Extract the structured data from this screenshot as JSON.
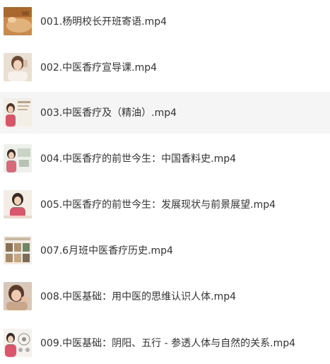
{
  "files": [
    {
      "name": "001.杨明校长开班寄语.mp4",
      "thumb_icon": "massage-thumbnail",
      "selected": false
    },
    {
      "name": "002.中医香疗宣导课.mp4",
      "thumb_icon": "woman-portrait-thumbnail",
      "selected": false
    },
    {
      "name": "003.中医香疗及（精油）.mp4",
      "thumb_icon": "lecture-slide-thumbnail",
      "selected": true
    },
    {
      "name": "004.中医香疗的前世今生：中国香料史.mp4",
      "thumb_icon": "lecture-slide-thumbnail",
      "selected": false
    },
    {
      "name": "005.中医香疗的前世今生：发展现状与前景展望.mp4",
      "thumb_icon": "presenter-thumbnail",
      "selected": false
    },
    {
      "name": "007.6月班中医香疗历史.mp4",
      "thumb_icon": "slide-grid-thumbnail",
      "selected": false
    },
    {
      "name": "008.中医基础：用中医的思维认识人体.mp4",
      "thumb_icon": "woman-portrait-thumbnail",
      "selected": false
    },
    {
      "name": "009.中医基础：阴阳、五行 - 参透人体与自然的关系.mp4",
      "thumb_icon": "presenter-diagram-thumbnail",
      "selected": false
    }
  ]
}
